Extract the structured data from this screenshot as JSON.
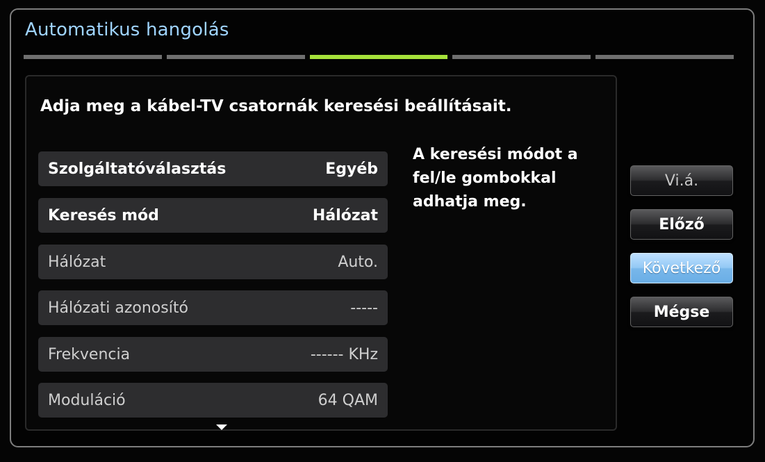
{
  "window": {
    "title": "Automatikus hangolás"
  },
  "progress": {
    "total_steps": 5,
    "current_step": 3
  },
  "instruction": "Adja meg a kábel-TV csatornák keresési beállításait.",
  "settings": [
    {
      "label": "Szolgáltatóválasztás",
      "value": "Egyéb",
      "enabled": true
    },
    {
      "label": "Keresés mód",
      "value": "Hálózat",
      "enabled": true
    },
    {
      "label": "Hálózat",
      "value": "Auto.",
      "enabled": false
    },
    {
      "label": "Hálózati azonosító",
      "value": "-----",
      "enabled": false
    },
    {
      "label": "Frekvencia",
      "value": "------ KHz",
      "enabled": false
    },
    {
      "label": "Moduláció",
      "value": "64 QAM",
      "enabled": false
    }
  ],
  "help": {
    "line1": "A keresési módot a",
    "line2": "fel/le gombokkal",
    "line3": "adhatja meg."
  },
  "buttons": {
    "reset": "Vi.á.",
    "previous": "Előző",
    "next": "Következő",
    "cancel": "Mégse"
  },
  "icons": {
    "more_below": "chevron-down-icon"
  },
  "colors": {
    "title": "#9fd4ff",
    "progress_active": "#a6e23a",
    "progress_inactive": "#6f6f6f",
    "focused_button": "#93c9f5"
  }
}
